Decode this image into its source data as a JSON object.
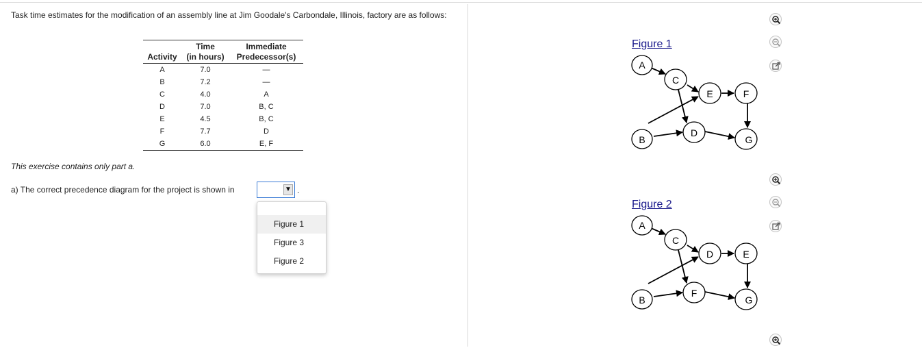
{
  "prompt": "Task time estimates for the modification of an assembly line at Jim Goodale's Carbondale, Illinois, factory are as follows:",
  "table": {
    "headers": {
      "activity": "Activity",
      "time_line1": "Time",
      "time_line2": "(in hours)",
      "pred_line1": "Immediate",
      "pred_line2": "Predecessor(s)"
    },
    "rows": [
      {
        "activity": "A",
        "time": "7.0",
        "pred": "—"
      },
      {
        "activity": "B",
        "time": "7.2",
        "pred": "—"
      },
      {
        "activity": "C",
        "time": "4.0",
        "pred": "A"
      },
      {
        "activity": "D",
        "time": "7.0",
        "pred": "B, C"
      },
      {
        "activity": "E",
        "time": "4.5",
        "pred": "B, C"
      },
      {
        "activity": "F",
        "time": "7.7",
        "pred": "D"
      },
      {
        "activity": "G",
        "time": "6.0",
        "pred": "E, F"
      }
    ]
  },
  "note": "This exercise contains only part a.",
  "question": {
    "text": "a) The correct precedence diagram for the project is shown in",
    "selected": "",
    "trailing": ".",
    "options": [
      "Figure 1",
      "Figure 3",
      "Figure 2"
    ]
  },
  "figures": [
    {
      "label": "Figure 1",
      "nodes": [
        "A",
        "C",
        "E",
        "F",
        "B",
        "D",
        "G"
      ],
      "tools": [
        "zoom-in-icon",
        "zoom-out-icon",
        "open-external-icon"
      ]
    },
    {
      "label": "Figure 2",
      "nodes": [
        "A",
        "C",
        "D",
        "E",
        "B",
        "F",
        "G"
      ],
      "tools": [
        "zoom-in-icon",
        "zoom-out-icon",
        "open-external-icon"
      ]
    }
  ],
  "colors": {
    "link": "#1a1a8c",
    "select_border": "#3a7bd5"
  }
}
